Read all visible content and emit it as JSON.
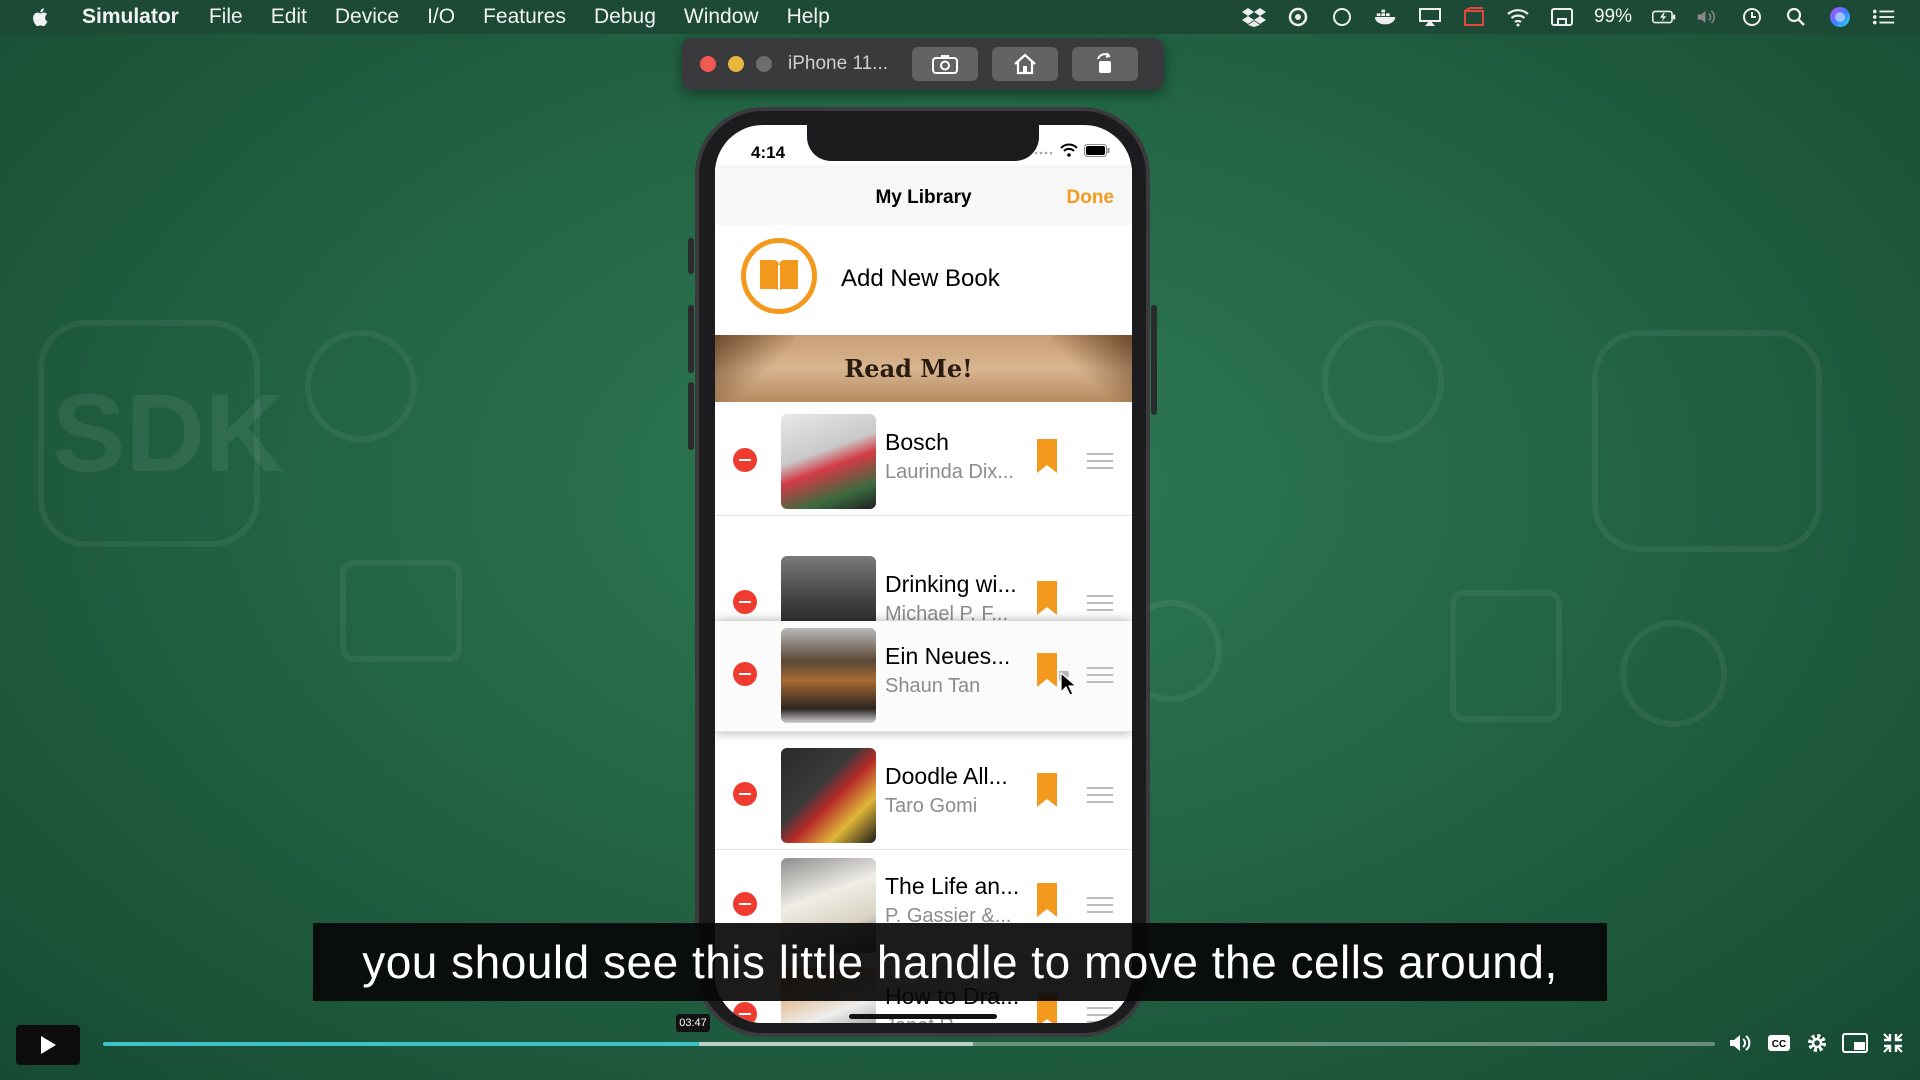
{
  "menubar": {
    "app_name": "Simulator",
    "items": [
      "File",
      "Edit",
      "Device",
      "I/O",
      "Features",
      "Debug",
      "Window",
      "Help"
    ],
    "battery": "99%",
    "tray_icons": [
      "dropbox-icon",
      "creative-cloud-icon",
      "circle-icon",
      "docker-icon",
      "airplay-icon",
      "screen-record-icon",
      "wifi-icon",
      "screen-mirror-icon",
      "battery-icon",
      "volume-icon",
      "clock-icon",
      "spotlight-icon",
      "siri-icon",
      "notification-center-icon"
    ]
  },
  "simulator": {
    "device_name": "iPhone 11...",
    "buttons": [
      "screenshot-icon",
      "home-icon",
      "rotate-icon"
    ]
  },
  "phone": {
    "status_time": "4:14",
    "nav_title": "My Library",
    "nav_done": "Done",
    "add_new_book": "Add New Book",
    "section_header": "Read Me!",
    "books": [
      {
        "title": "Bosch",
        "author": "Laurinda Dix..."
      },
      {
        "title": "Drinking wi...",
        "author": "Michael P. F..."
      },
      {
        "title": "Ein Neues...",
        "author": "Shaun Tan"
      },
      {
        "title": "Doodle All...",
        "author": "Taro Gomi"
      },
      {
        "title": "The Life an...",
        "author": "P. Gassier &..."
      },
      {
        "title": "How to Dra...",
        "author": "Janet R..."
      }
    ]
  },
  "caption": "you should see this little handle to move the cells around,",
  "video": {
    "time_tooltip": "03:47",
    "progress": 0.37,
    "buffered": 0.54
  },
  "colors": {
    "accent": "#f39a1e",
    "delete": "#ef3b30",
    "progress": "#3fc1c9"
  }
}
